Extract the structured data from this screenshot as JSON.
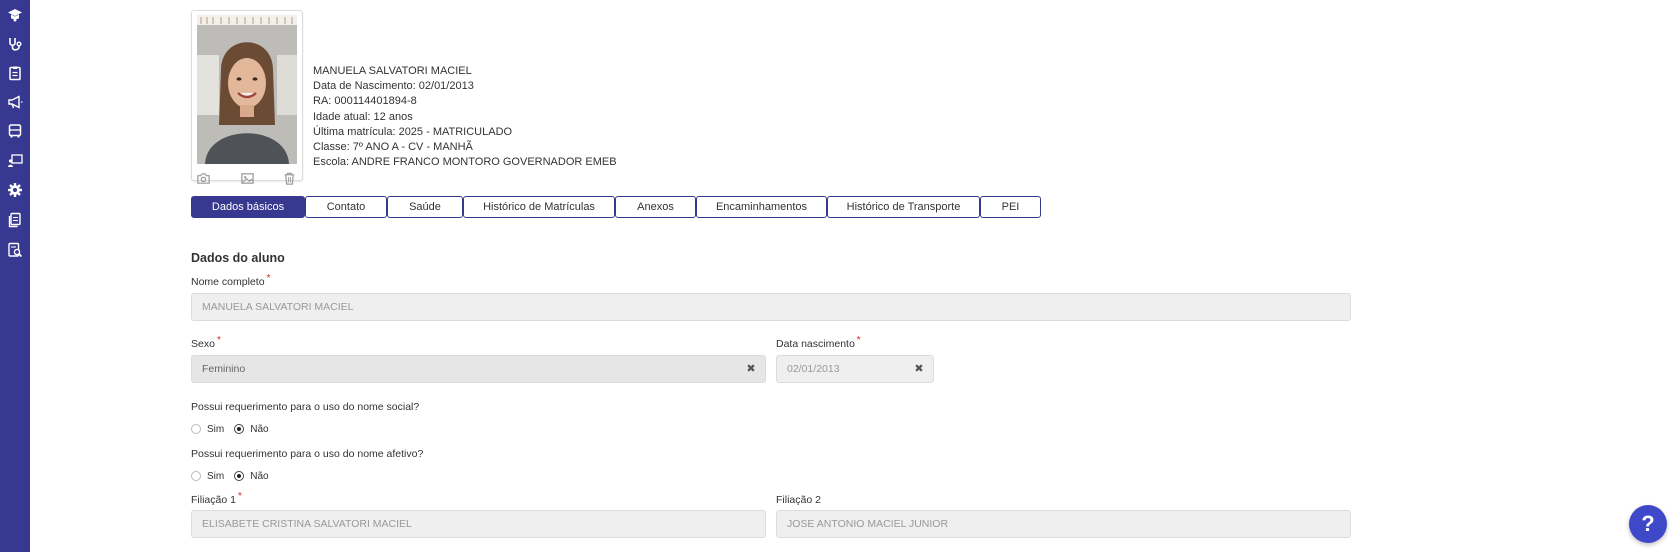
{
  "sidebar": {
    "items": [
      {
        "icon": "graduation-cap-icon"
      },
      {
        "icon": "stethoscope-icon"
      },
      {
        "icon": "clipboard-icon"
      },
      {
        "icon": "megaphone-icon"
      },
      {
        "icon": "bus-icon"
      },
      {
        "icon": "teacher-board-icon"
      },
      {
        "icon": "gear-icon"
      },
      {
        "icon": "documents-icon"
      },
      {
        "icon": "document-search-icon"
      }
    ],
    "color": "#36398f"
  },
  "student": {
    "name": "MANUELA SALVATORI MACIEL",
    "birth": "Data de Nascimento: 02/01/2013",
    "ra": "RA: 000114401894-8",
    "age": "Idade atual: 12 anos",
    "last_enrollment": "Última matrícula: 2025 - MATRICULADO",
    "class": "Classe: 7º ANO A - CV - MANHÃ",
    "school": "Escola: ANDRE FRANCO MONTORO GOVERNADOR EMEB"
  },
  "photo_actions": [
    "camera-icon",
    "image-icon",
    "trash-icon"
  ],
  "tabs": [
    {
      "label": "Dados básicos",
      "active": true
    },
    {
      "label": "Contato",
      "active": false
    },
    {
      "label": "Saúde",
      "active": false
    },
    {
      "label": "Histórico de Matrículas",
      "active": false
    },
    {
      "label": "Anexos",
      "active": false
    },
    {
      "label": "Encaminhamentos",
      "active": false
    },
    {
      "label": "Histórico de Transporte",
      "active": false
    },
    {
      "label": "PEI",
      "active": false
    }
  ],
  "form": {
    "section_title": "Dados do aluno",
    "required_marker": "*",
    "nome_completo": {
      "label": "Nome completo",
      "value": "MANUELA SALVATORI MACIEL"
    },
    "sexo": {
      "label": "Sexo",
      "value": "Feminino"
    },
    "data_nascimento": {
      "label": "Data nascimento",
      "value": "02/01/2013"
    },
    "nome_social": {
      "question": "Possui requerimento para o uso do nome social?",
      "options": [
        "Sim",
        "Não"
      ],
      "selected": "Não"
    },
    "nome_afetivo": {
      "question": "Possui requerimento para o uso do nome afetivo?",
      "options": [
        "Sim",
        "Não"
      ],
      "selected": "Não"
    },
    "filiacao1": {
      "label": "Filiação 1",
      "value": "ELISABETE CRISTINA SALVATORI MACIEL"
    },
    "filiacao2": {
      "label": "Filiação 2",
      "value": "JOSE ANTONIO MACIEL JUNIOR"
    },
    "clear_symbol": "✖"
  },
  "help": {
    "label": "?",
    "color": "#3f48c8"
  }
}
